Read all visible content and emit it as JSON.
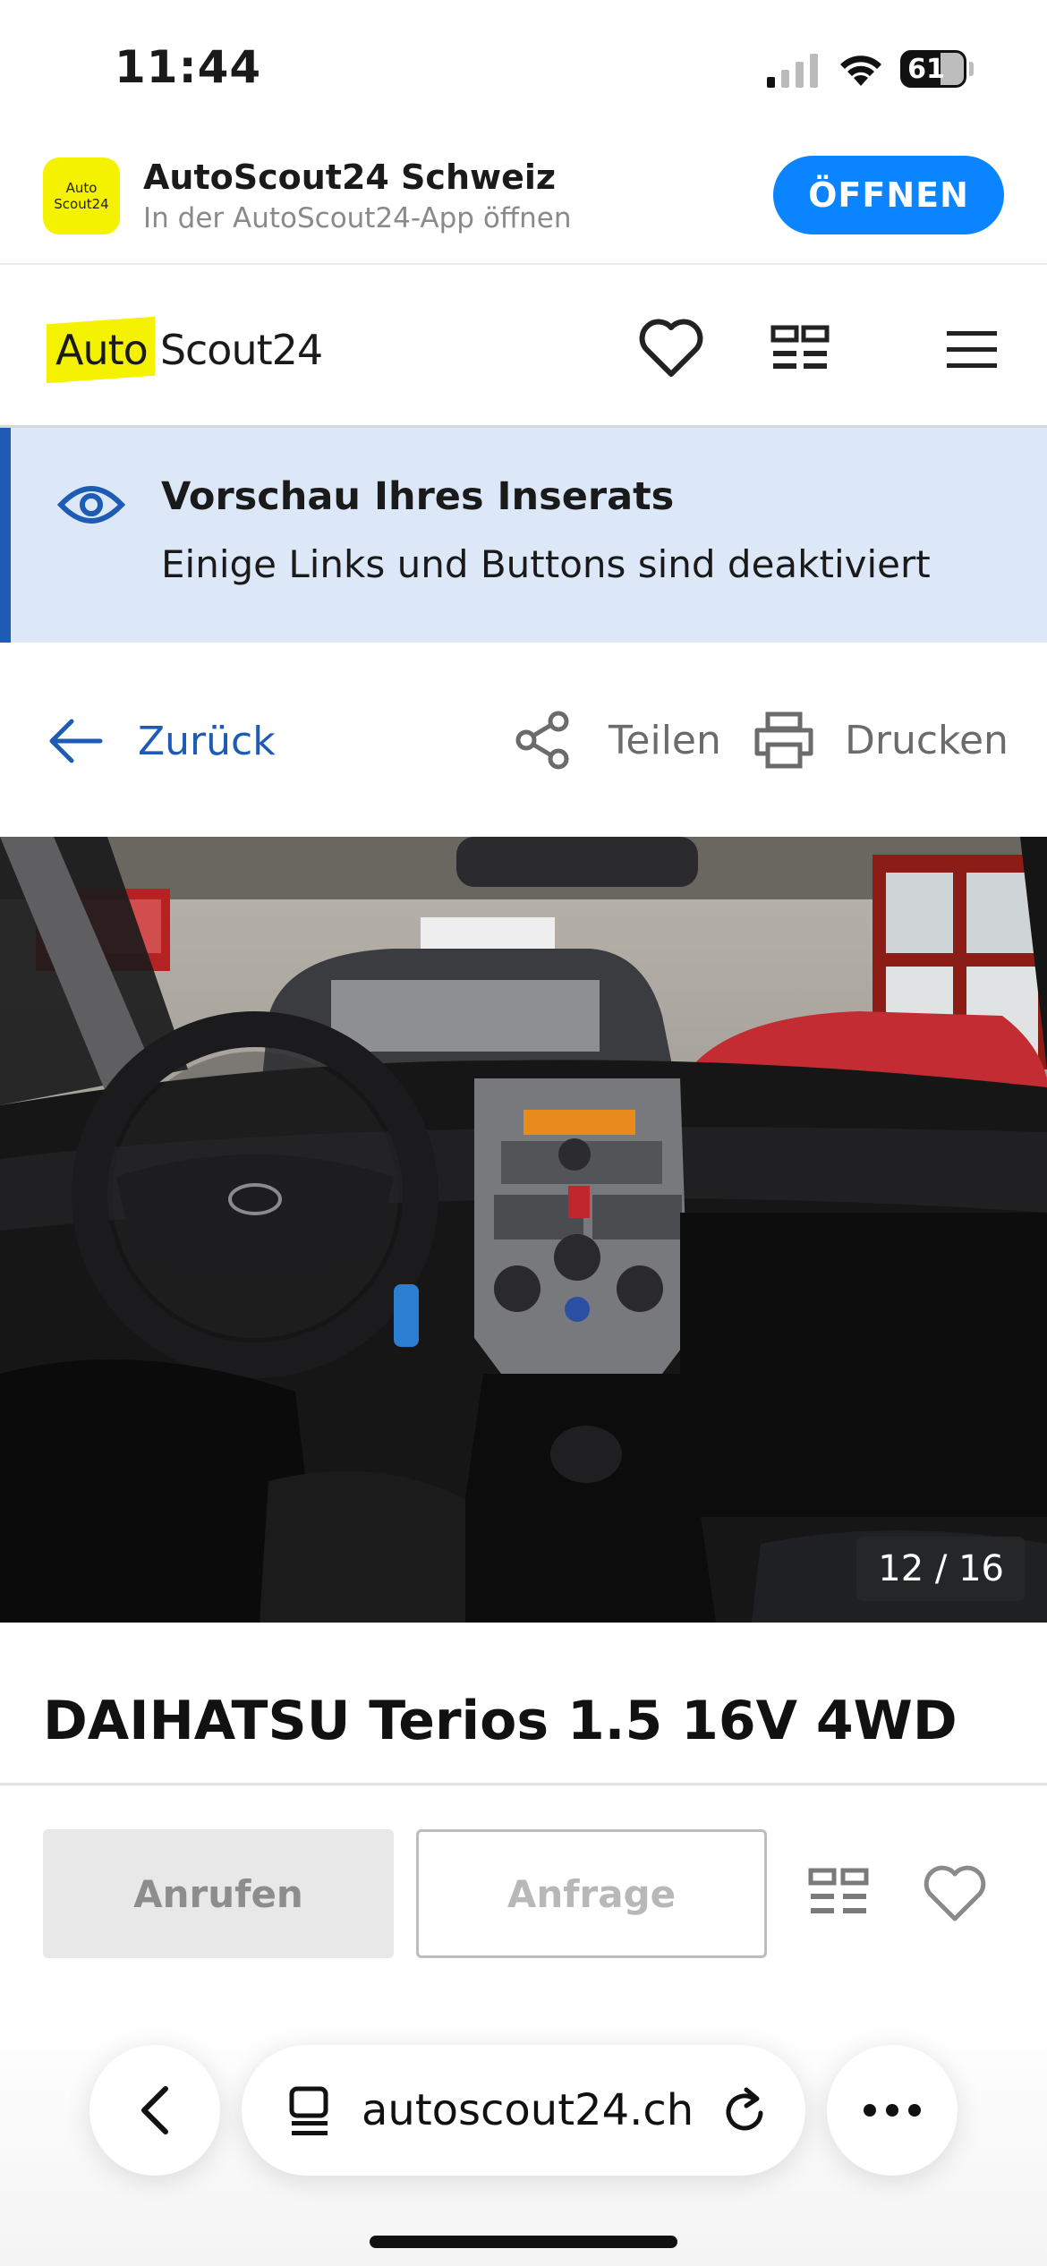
{
  "status_bar": {
    "time": "11:44",
    "battery": "61"
  },
  "app_banner": {
    "icon_line1": "Auto",
    "icon_line2": "Scout24",
    "app_name": "AutoScout24 Schweiz",
    "subtitle": "In der AutoScout24-App öffnen",
    "open_label": "ÖFFNEN"
  },
  "header": {
    "logo_part1": "Auto",
    "logo_part2": "Scout24",
    "icons": [
      "heart-icon",
      "compare-icon",
      "menu-icon"
    ]
  },
  "notice": {
    "title": "Vorschau Ihres Inserats",
    "text": "Einige Links und Buttons sind deaktiviert"
  },
  "actions": {
    "back_label": "Zurück",
    "share_label": "Teilen",
    "print_label": "Drucken"
  },
  "gallery": {
    "counter": "12 / 16"
  },
  "listing": {
    "title": "DAIHATSU Terios 1.5 16V 4WD"
  },
  "contact": {
    "call_label": "Anrufen",
    "inquiry_label": "Anfrage"
  },
  "browser": {
    "url": "autoscout24.ch"
  },
  "colors": {
    "accent": "#1e5bb5",
    "brand_yellow": "#f5f200",
    "ios_blue": "#0a84ff"
  }
}
